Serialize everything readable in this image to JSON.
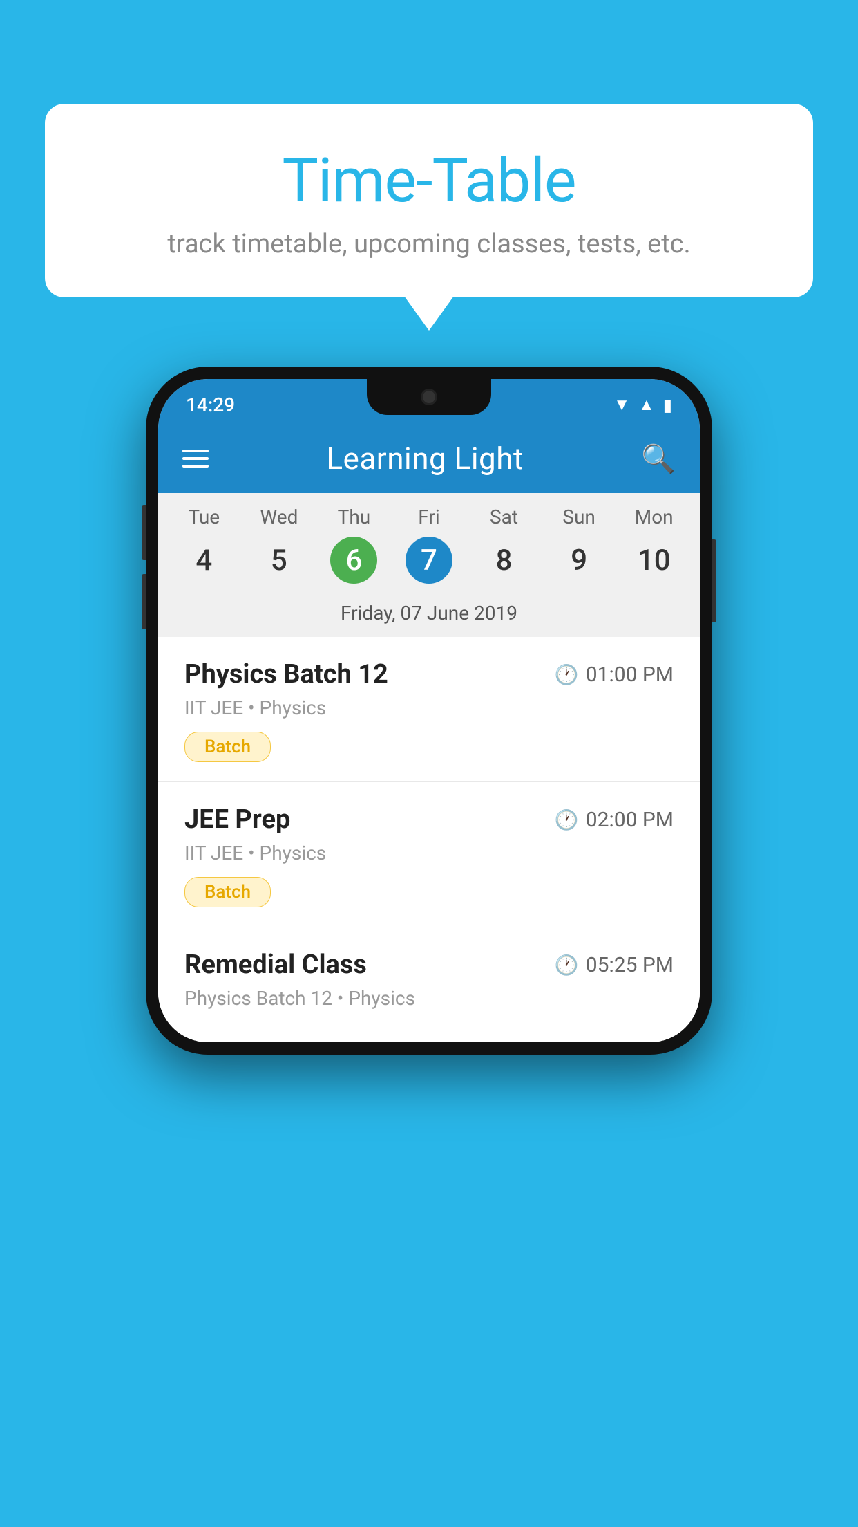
{
  "background_color": "#29B6E8",
  "bubble": {
    "title": "Time-Table",
    "subtitle": "track timetable, upcoming classes, tests, etc."
  },
  "phone": {
    "status_bar": {
      "time": "14:29"
    },
    "toolbar": {
      "app_name": "Learning Light"
    },
    "calendar": {
      "days": [
        "Tue",
        "Wed",
        "Thu",
        "Fri",
        "Sat",
        "Sun",
        "Mon"
      ],
      "dates": [
        "4",
        "5",
        "6",
        "7",
        "8",
        "9",
        "10"
      ],
      "today_index": 2,
      "selected_index": 3,
      "selected_date_label": "Friday, 07 June 2019"
    },
    "schedule": [
      {
        "title": "Physics Batch 12",
        "time": "01:00 PM",
        "subtitle": "IIT JEE • Physics",
        "badge": "Batch"
      },
      {
        "title": "JEE Prep",
        "time": "02:00 PM",
        "subtitle": "IIT JEE • Physics",
        "badge": "Batch"
      },
      {
        "title": "Remedial Class",
        "time": "05:25 PM",
        "subtitle": "Physics Batch 12 • Physics",
        "badge": null
      }
    ]
  }
}
